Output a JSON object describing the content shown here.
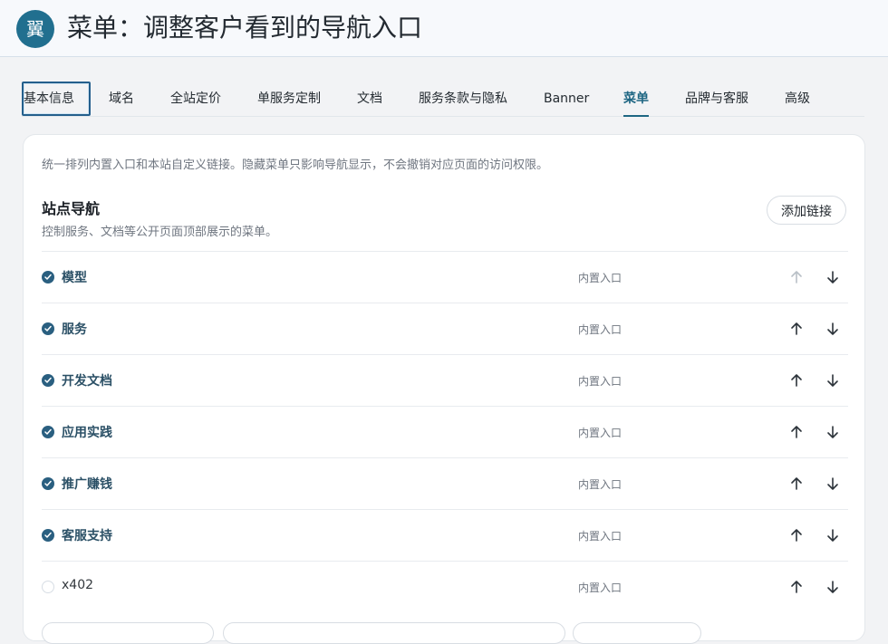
{
  "header": {
    "icon": "翼",
    "title": "菜单：调整客户看到的导航入口"
  },
  "tabs": [
    {
      "label": "基本信息",
      "state": "focused"
    },
    {
      "label": "域名"
    },
    {
      "label": "全站定价"
    },
    {
      "label": "单服务定制"
    },
    {
      "label": "文档"
    },
    {
      "label": "服务条款与隐私"
    },
    {
      "label": "Banner"
    },
    {
      "label": "菜单",
      "state": "active"
    },
    {
      "label": "品牌与客服"
    },
    {
      "label": "高级"
    }
  ],
  "panel": {
    "intro": "统一排列内置入口和本站自定义链接。隐藏菜单只影响导航显示，不会撤销对应页面的访问权限。",
    "section_title": "站点导航",
    "section_desc": "控制服务、文档等公开页面顶部展示的菜单。",
    "add_button": "添加链接"
  },
  "menu_items": [
    {
      "label": "模型",
      "type": "内置入口",
      "checked": true,
      "up_disabled": true
    },
    {
      "label": "服务",
      "type": "内置入口",
      "checked": true
    },
    {
      "label": "开发文档",
      "type": "内置入口",
      "checked": true
    },
    {
      "label": "应用实践",
      "type": "内置入口",
      "checked": true
    },
    {
      "label": "推广赚钱",
      "type": "内置入口",
      "checked": true
    },
    {
      "label": "客服支持",
      "type": "内置入口",
      "checked": true
    },
    {
      "label": "x402",
      "type": "内置入口",
      "checked": false
    }
  ],
  "colors": {
    "accent": "#1e6683",
    "checked": "#2a5f80",
    "muted_text": "#6f7680"
  },
  "icons": [
    "check-icon",
    "arrow-up-icon",
    "arrow-down-icon"
  ]
}
